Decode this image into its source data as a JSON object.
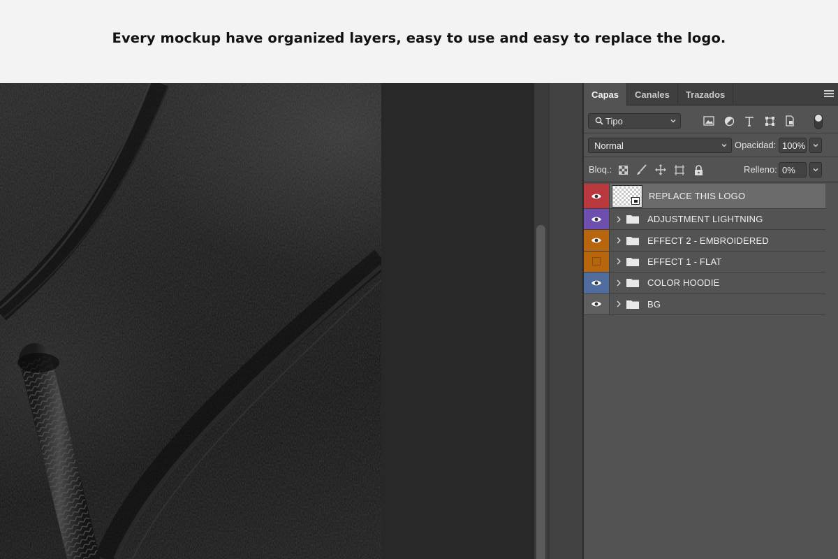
{
  "banner": {
    "headline": "Every mockup have organized layers, easy to use and easy to replace the logo."
  },
  "panel": {
    "tabs": [
      {
        "label": "Capas",
        "active": true
      },
      {
        "label": "Canales",
        "active": false
      },
      {
        "label": "Trazados",
        "active": false
      }
    ],
    "filter": {
      "kind_label": "Tipo",
      "filter_icons": [
        "image-filter-icon",
        "adjustment-filter-icon",
        "type-filter-icon",
        "shape-filter-icon",
        "smart-object-filter-icon"
      ]
    },
    "blend": {
      "mode": "Normal",
      "opacity_label": "Opacidad:",
      "opacity_value": "100%"
    },
    "lock": {
      "label": "Bloq.:",
      "icons": [
        "lock-transparent-icon",
        "lock-image-icon",
        "lock-position-icon",
        "lock-artboard-icon",
        "lock-all-icon"
      ],
      "fill_label": "Relleno:",
      "fill_value": "0%"
    },
    "layers": [
      {
        "name": "REPLACE THIS LOGO",
        "type": "smart-object",
        "color": "#b8383d",
        "visible": true,
        "selected": true
      },
      {
        "name": "ADJUSTMENT LIGHTNING",
        "type": "group",
        "color": "#6f4fae",
        "visible": true,
        "selected": false
      },
      {
        "name": "EFFECT 2 - EMBROIDERED",
        "type": "group",
        "color": "#b8660d",
        "visible": true,
        "selected": false
      },
      {
        "name": "EFFECT 1 - FLAT",
        "type": "group",
        "color": "#b8660d",
        "visible": false,
        "selected": false
      },
      {
        "name": "COLOR HOODIE",
        "type": "group",
        "color": "#4f6c9c",
        "visible": true,
        "selected": false
      },
      {
        "name": "BG",
        "type": "group",
        "color": "#5f5f5f",
        "visible": true,
        "selected": false
      }
    ]
  }
}
